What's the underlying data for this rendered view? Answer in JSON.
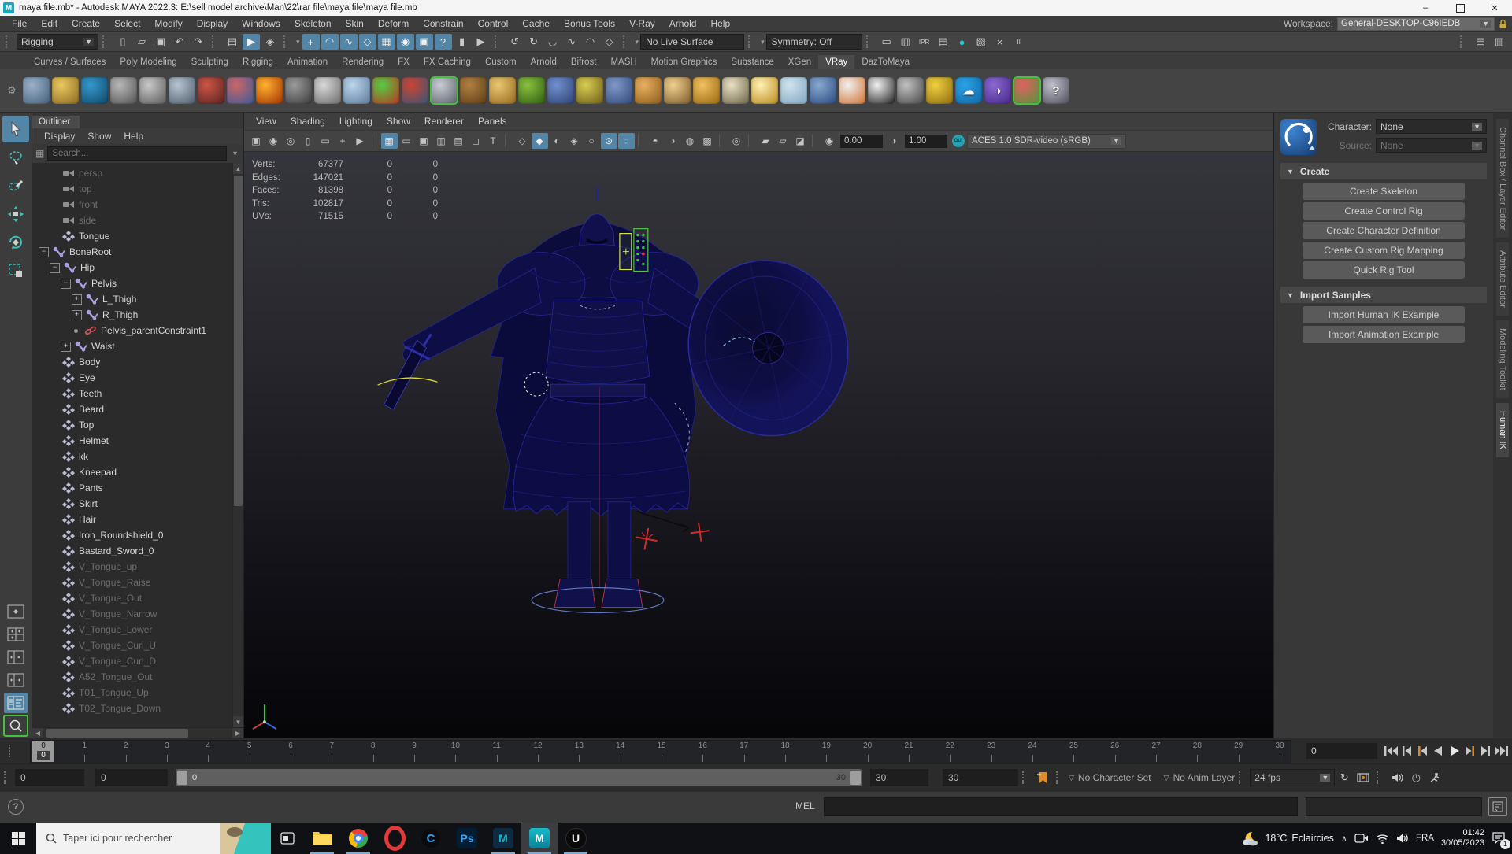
{
  "window": {
    "title": "maya file.mb* - Autodesk MAYA 2022.3: E:\\sell model archive\\Man\\22\\rar file\\maya file\\maya file.mb",
    "minimize": "–",
    "close": "✕"
  },
  "menubar": {
    "items": [
      "File",
      "Edit",
      "Create",
      "Select",
      "Modify",
      "Display",
      "Windows",
      "Skeleton",
      "Skin",
      "Deform",
      "Constrain",
      "Control",
      "Cache",
      "Bonus Tools",
      "V-Ray",
      "Arnold",
      "Help"
    ],
    "workspace_label": "Workspace:",
    "workspace_value": "General-DESKTOP-C96IEDB"
  },
  "statusline": {
    "mode": "Rigging",
    "live_surface": "No Live Surface",
    "symmetry": "Symmetry: Off",
    "file_icons": [
      {
        "name": "new-scene",
        "glyph": "▯"
      },
      {
        "name": "open-scene",
        "glyph": "▱"
      },
      {
        "name": "save-scene",
        "glyph": "▣"
      },
      {
        "name": "undo",
        "glyph": "↶"
      },
      {
        "name": "redo",
        "glyph": "↷"
      }
    ],
    "selection_icons": [
      {
        "name": "select-hierarchy",
        "glyph": "▤"
      },
      {
        "name": "select-object",
        "glyph": "▶",
        "active": true
      },
      {
        "name": "select-component",
        "glyph": "◈"
      }
    ],
    "snap_icons": [
      {
        "name": "snap-grid",
        "glyph": "+",
        "active": true
      },
      {
        "name": "snap-curve",
        "glyph": "◠",
        "active": true
      },
      {
        "name": "snap-point",
        "glyph": "∿",
        "active": true
      },
      {
        "name": "snap-plane",
        "glyph": "◇",
        "active": true
      },
      {
        "name": "snap-view",
        "glyph": "▦",
        "active": true
      },
      {
        "name": "snap-center",
        "glyph": "◉",
        "active": true
      },
      {
        "name": "snap-together",
        "glyph": "▣",
        "active": true
      },
      {
        "name": "snap-help",
        "glyph": "?",
        "active": true
      },
      {
        "name": "lock-selection",
        "glyph": "▮"
      },
      {
        "name": "highlight-selection",
        "glyph": "▶"
      }
    ],
    "history_icons": [
      {
        "name": "construction-history",
        "glyph": "↺"
      },
      {
        "name": "redo-history",
        "glyph": "↻"
      },
      {
        "name": "keyframe",
        "glyph": "◡"
      },
      {
        "name": "curve-tool",
        "glyph": "∿"
      },
      {
        "name": "surface-tool",
        "glyph": "◠"
      },
      {
        "name": "deform-tool",
        "glyph": "◇"
      }
    ],
    "render_icons": [
      {
        "name": "render-current-frame",
        "glyph": "▭"
      },
      {
        "name": "render-region",
        "glyph": "▥"
      },
      {
        "name": "ipr-render",
        "glyph": "IPR",
        "small": true
      },
      {
        "name": "render-settings",
        "glyph": "▤"
      },
      {
        "name": "render-view",
        "glyph": "●",
        "teal": true
      },
      {
        "name": "light-editor",
        "glyph": "▧"
      },
      {
        "name": "paint-effects",
        "glyph": "×"
      },
      {
        "name": "pause-viewport",
        "glyph": "II",
        "small": true
      }
    ],
    "panel_toggles": [
      {
        "name": "toggle-sidebar-a",
        "glyph": "▤"
      },
      {
        "name": "toggle-sidebar-b",
        "glyph": "▥"
      }
    ]
  },
  "shelf": {
    "active_tab": "VRay",
    "tabs": [
      "Curves / Surfaces",
      "Poly Modeling",
      "Sculpting",
      "Rigging",
      "Animation",
      "Rendering",
      "FX",
      "FX Caching",
      "Custom",
      "Arnold",
      "Bifrost",
      "MASH",
      "Motion Graphics",
      "Substance",
      "XGen",
      "VRay",
      "DazToMaya"
    ],
    "icons": [
      {
        "name": "vray-save-scene",
        "c1": "#9ab0c8",
        "c2": "#44607a"
      },
      {
        "name": "vray-export-proxy",
        "c1": "#e8c860",
        "c2": "#8a6820"
      },
      {
        "name": "vray-import-list",
        "c1": "#3399cc",
        "c2": "#114466"
      },
      {
        "name": "vray-plugin",
        "c1": "#b8b8b8",
        "c2": "#505050"
      },
      {
        "name": "vray-notes",
        "c1": "#c8c8c8",
        "c2": "#5a5a5a"
      },
      {
        "name": "vray-material-sphere",
        "c1": "#b8c4d0",
        "c2": "#4a5a6a"
      },
      {
        "name": "vray-physical-camera",
        "c1": "#cc5544",
        "c2": "#552222"
      },
      {
        "name": "vray-spheres",
        "c1": "#cc6666",
        "c2": "#3a5a9a"
      },
      {
        "name": "vray-fire",
        "c1": "#ffb030",
        "c2": "#a03000"
      },
      {
        "name": "vray-mesh-export",
        "c1": "#9a9a9a",
        "c2": "#3a3a3a"
      },
      {
        "name": "vray-page",
        "c1": "#d8d8d8",
        "c2": "#6a6a6a"
      },
      {
        "name": "vray-water-drop",
        "c1": "#bcd4ec",
        "c2": "#5a7a9a"
      },
      {
        "name": "vray-heatmap",
        "c1": "#55cc44",
        "c2": "#bb3322"
      },
      {
        "name": "vray-wire-red",
        "c1": "#cc4433",
        "c2": "#335577"
      },
      {
        "name": "vray-moon",
        "c1": "#c8ccd4",
        "c2": "#5a5e66",
        "selected": true
      },
      {
        "name": "vray-wood-texture",
        "c1": "#b08040",
        "c2": "#5a3a18"
      },
      {
        "name": "vray-lantern",
        "c1": "#e8c870",
        "c2": "#95661e"
      },
      {
        "name": "vray-grass",
        "c1": "#88c040",
        "c2": "#2f5a10"
      },
      {
        "name": "vray-flower",
        "c1": "#7090d0",
        "c2": "#2e4070"
      },
      {
        "name": "vray-rope",
        "c1": "#d8cc50",
        "c2": "#6a5a1a"
      },
      {
        "name": "vray-sphere-wire",
        "c1": "#8098c8",
        "c2": "#2e4878"
      },
      {
        "name": "vray-dome-light",
        "c1": "#e8b060",
        "c2": "#8a5a1a"
      },
      {
        "name": "vray-rect-light",
        "c1": "#f0d090",
        "c2": "#7a5a28"
      },
      {
        "name": "vray-sphere-light",
        "c1": "#f0c060",
        "c2": "#96680e"
      },
      {
        "name": "vray-spot-light",
        "c1": "#e8e0c0",
        "c2": "#6a6248"
      },
      {
        "name": "vray-sun-light",
        "c1": "#fff0b0",
        "c2": "#b8881c"
      },
      {
        "name": "vray-plane",
        "c1": "#cfe4ef",
        "c2": "#7fa4bf"
      },
      {
        "name": "vray-sphere-blue",
        "c1": "#88a8d0",
        "c2": "#28487e"
      },
      {
        "name": "vray-sphere-striped",
        "c1": "#f0f0f0",
        "c2": "#d07030"
      },
      {
        "name": "vray-checker",
        "c1": "#f0f0f0",
        "c2": "#1e1e1e"
      },
      {
        "name": "vray-render-window",
        "c1": "#c0c0c0",
        "c2": "#454545"
      },
      {
        "name": "vray-light-lister",
        "c1": "#f0d040",
        "c2": "#8a6a0e"
      },
      {
        "name": "vray-frame-buffer",
        "c1": "#2aa3e8",
        "c2": "#1264a0",
        "shape": "square",
        "glyph": "☁"
      },
      {
        "name": "vray-palette",
        "c1": "#8a6ad0",
        "c2": "#45248a",
        "shape": "square",
        "glyph": "◑"
      },
      {
        "name": "vray-balloons",
        "c1": "#e06060",
        "c2": "#4a9a3a",
        "selected": true
      },
      {
        "name": "vray-help",
        "c1": "#c0c0cc",
        "c2": "#4c4c58",
        "glyph": "?"
      }
    ]
  },
  "toolbox": {
    "tools": [
      {
        "name": "select-tool",
        "active": true
      },
      {
        "name": "lasso-tool"
      },
      {
        "name": "paint-selection-tool"
      },
      {
        "name": "move-tool"
      },
      {
        "name": "rotate-tool"
      },
      {
        "name": "scale-tool"
      }
    ],
    "layouts": [
      {
        "name": "layout-single-pane"
      },
      {
        "name": "layout-four-pane"
      },
      {
        "name": "layout-two-pane-side"
      },
      {
        "name": "layout-two-pane-stacked"
      },
      {
        "name": "layout-outliner-persp",
        "active": true
      },
      {
        "name": "layout-zoom",
        "zoom": true
      }
    ]
  },
  "outliner": {
    "title": "Outliner",
    "menus": [
      "Display",
      "Show",
      "Help"
    ],
    "search_placeholder": "Search...",
    "items": [
      {
        "label": "persp",
        "icon": "camera",
        "depth": 1,
        "dim": true
      },
      {
        "label": "top",
        "icon": "camera",
        "depth": 1,
        "dim": true
      },
      {
        "label": "front",
        "icon": "camera",
        "depth": 1,
        "dim": true
      },
      {
        "label": "side",
        "icon": "camera",
        "depth": 1,
        "dim": true
      },
      {
        "label": "Tongue",
        "icon": "mesh",
        "depth": 1
      },
      {
        "label": "BoneRoot",
        "icon": "joint",
        "depth": 0,
        "exp": "minus"
      },
      {
        "label": "Hip",
        "icon": "joint",
        "depth": 1,
        "exp": "minus"
      },
      {
        "label": "Pelvis",
        "icon": "joint",
        "depth": 2,
        "exp": "minus"
      },
      {
        "label": "L_Thigh",
        "icon": "joint",
        "depth": 3,
        "exp": "plus"
      },
      {
        "label": "R_Thigh",
        "icon": "joint",
        "depth": 3,
        "exp": "plus"
      },
      {
        "label": "Pelvis_parentConstraint1",
        "icon": "constraint",
        "depth": 3,
        "exp": "dot"
      },
      {
        "label": "Waist",
        "icon": "joint",
        "depth": 2,
        "exp": "plus"
      },
      {
        "label": "Body",
        "icon": "mesh",
        "depth": 1
      },
      {
        "label": "Eye",
        "icon": "mesh",
        "depth": 1
      },
      {
        "label": "Teeth",
        "icon": "mesh",
        "depth": 1
      },
      {
        "label": "Beard",
        "icon": "mesh",
        "depth": 1
      },
      {
        "label": "Top",
        "icon": "mesh",
        "depth": 1
      },
      {
        "label": "Helmet",
        "icon": "mesh",
        "depth": 1
      },
      {
        "label": "kk",
        "icon": "mesh",
        "depth": 1
      },
      {
        "label": "Kneepad",
        "icon": "mesh",
        "depth": 1
      },
      {
        "label": "Pants",
        "icon": "mesh",
        "depth": 1
      },
      {
        "label": "Skirt",
        "icon": "mesh",
        "depth": 1
      },
      {
        "label": "Hair",
        "icon": "mesh",
        "depth": 1
      },
      {
        "label": "Iron_Roundshield_0",
        "icon": "mesh",
        "depth": 1
      },
      {
        "label": "Bastard_Sword_0",
        "icon": "mesh",
        "depth": 1
      },
      {
        "label": "V_Tongue_up",
        "icon": "mesh",
        "depth": 1,
        "dim": true
      },
      {
        "label": "V_Tongue_Raise",
        "icon": "mesh",
        "depth": 1,
        "dim": true
      },
      {
        "label": "V_Tongue_Out",
        "icon": "mesh",
        "depth": 1,
        "dim": true
      },
      {
        "label": "V_Tongue_Narrow",
        "icon": "mesh",
        "depth": 1,
        "dim": true
      },
      {
        "label": "V_Tongue_Lower",
        "icon": "mesh",
        "depth": 1,
        "dim": true
      },
      {
        "label": "V_Tongue_Curl_U",
        "icon": "mesh",
        "depth": 1,
        "dim": true
      },
      {
        "label": "V_Tongue_Curl_D",
        "icon": "mesh",
        "depth": 1,
        "dim": true
      },
      {
        "label": "A52_Tongue_Out",
        "icon": "mesh",
        "depth": 1,
        "dim": true
      },
      {
        "label": "T01_Tongue_Up",
        "icon": "mesh",
        "depth": 1,
        "dim": true
      },
      {
        "label": "T02_Tongue_Down",
        "icon": "mesh",
        "depth": 1,
        "dim": true
      }
    ]
  },
  "viewport": {
    "menus": [
      "View",
      "Shading",
      "Lighting",
      "Show",
      "Renderer",
      "Panels"
    ],
    "icons": [
      {
        "name": "select-camera",
        "glyph": "▣"
      },
      {
        "name": "lock-camera",
        "glyph": "◉"
      },
      {
        "name": "camera-attributes",
        "glyph": "◎"
      },
      {
        "name": "bookmarks",
        "glyph": "▯"
      },
      {
        "name": "image-plane",
        "glyph": "▭"
      },
      {
        "name": "pan-zoom",
        "glyph": "+"
      },
      {
        "name": "pick-object",
        "glyph": "▶"
      },
      {
        "sep": true
      },
      {
        "name": "grid",
        "glyph": "▦",
        "active": true
      },
      {
        "name": "film-gate",
        "glyph": "▭"
      },
      {
        "name": "resolution-gate",
        "glyph": "▣"
      },
      {
        "name": "gate-mask",
        "glyph": "▥"
      },
      {
        "name": "field-chart",
        "glyph": "▤"
      },
      {
        "name": "safe-action",
        "glyph": "◻"
      },
      {
        "name": "safe-title",
        "glyph": "T"
      },
      {
        "sep": true
      },
      {
        "name": "wireframe",
        "glyph": "◇"
      },
      {
        "name": "smooth-shade",
        "glyph": "◆",
        "active": true
      },
      {
        "name": "textured",
        "glyph": "◐"
      },
      {
        "name": "wireframe-on-shaded",
        "glyph": "◈"
      },
      {
        "name": "xray",
        "glyph": "○"
      },
      {
        "name": "xray-joints",
        "glyph": "⊙",
        "active": true
      },
      {
        "name": "xray-active",
        "glyph": "◌",
        "active": true
      },
      {
        "sep": true
      },
      {
        "name": "lighting-all",
        "glyph": "◓"
      },
      {
        "name": "shadows",
        "glyph": "◑"
      },
      {
        "name": "occlusion",
        "glyph": "◍"
      },
      {
        "name": "anti-aliasing",
        "glyph": "▩"
      },
      {
        "sep": true
      },
      {
        "name": "isolate-select",
        "glyph": "◎"
      },
      {
        "sep": true
      },
      {
        "name": "tear-off-copy",
        "glyph": "▰"
      },
      {
        "name": "copy-view",
        "glyph": "▱"
      },
      {
        "name": "overlay-panel",
        "glyph": "◪"
      }
    ],
    "exposure": "0.00",
    "gamma": "1.00",
    "view_transform": "ACES 1.0 SDR-video (sRGB)",
    "hud": {
      "rows": [
        {
          "label": "Verts:",
          "v1": "67377",
          "v2": "0",
          "v3": "0"
        },
        {
          "label": "Edges:",
          "v1": "147021",
          "v2": "0",
          "v3": "0"
        },
        {
          "label": "Faces:",
          "v1": "81398",
          "v2": "0",
          "v3": "0"
        },
        {
          "label": "Tris:",
          "v1": "102817",
          "v2": "0",
          "v3": "0"
        },
        {
          "label": "UVs:",
          "v1": "71515",
          "v2": "0",
          "v3": "0"
        }
      ]
    }
  },
  "humanik": {
    "character_label": "Character:",
    "character_value": "None",
    "source_label": "Source:",
    "source_value": "None",
    "sections": [
      {
        "title": "Create",
        "buttons": [
          "Create Skeleton",
          "Create Control Rig",
          "Create Character Definition",
          "Create Custom Rig Mapping",
          "Quick Rig Tool"
        ]
      },
      {
        "title": "Import Samples",
        "buttons": [
          "Import Human IK Example",
          "Import Animation Example"
        ]
      }
    ]
  },
  "right_tabs": [
    {
      "label": "Channel Box / Layer Editor"
    },
    {
      "label": "Attribute Editor"
    },
    {
      "label": "Modeling Toolkit"
    },
    {
      "label": "Human IK",
      "active": true
    }
  ],
  "timeline": {
    "ticks": [
      "0",
      "1",
      "2",
      "3",
      "4",
      "5",
      "6",
      "7",
      "8",
      "9",
      "10",
      "11",
      "12",
      "13",
      "14",
      "15",
      "16",
      "17",
      "18",
      "19",
      "20",
      "21",
      "22",
      "23",
      "24",
      "25",
      "26",
      "27",
      "28",
      "29",
      "30"
    ],
    "playhead_tick": "0",
    "current_frame": "0",
    "playback": [
      "go-to-start",
      "step-back-frame",
      "step-back-key",
      "play-backwards",
      "play-forwards",
      "step-forward-key",
      "step-forward-frame",
      "go-to-end"
    ],
    "range_start_outer": "0",
    "range_start_inner": "0",
    "slider_start": "0",
    "slider_end": "30",
    "range_end_inner": "30",
    "range_end_outer": "30",
    "character_set": "No Character Set",
    "anim_layer": "No Anim Layer",
    "fps": "24 fps"
  },
  "command_line": {
    "mel_label": "MEL"
  },
  "taskbar": {
    "search_placeholder": "Taper ici pour rechercher",
    "apps": [
      {
        "name": "file-explorer",
        "kind": "folder",
        "running": true
      },
      {
        "name": "chrome",
        "kind": "chrome",
        "running": true
      },
      {
        "name": "opera",
        "kind": "opera",
        "running": false
      },
      {
        "name": "converter-c",
        "kind": "cclean",
        "label": "C",
        "running": false
      },
      {
        "name": "photoshop",
        "kind": "ps",
        "label": "Ps",
        "running": false
      },
      {
        "name": "maya-2022",
        "kind": "maya-dark",
        "label": "M",
        "running": true
      },
      {
        "name": "maya-current",
        "kind": "maya-teal",
        "label": "M",
        "running": true,
        "focused": true
      },
      {
        "name": "unreal-engine",
        "kind": "unreal",
        "label": "U",
        "running": true
      }
    ],
    "tray": {
      "temperature": "18°C",
      "weather": "Eclaircies",
      "language": "FRA",
      "time": "01:42",
      "date": "30/05/2023",
      "badge": "1"
    }
  },
  "colors": {
    "accent_active": "#5285a6",
    "shelf_selected": "#43c33c",
    "wire_blue": "#2a2ab0",
    "marker_red": "#d42a2a",
    "key_orange": "#d8862c"
  }
}
